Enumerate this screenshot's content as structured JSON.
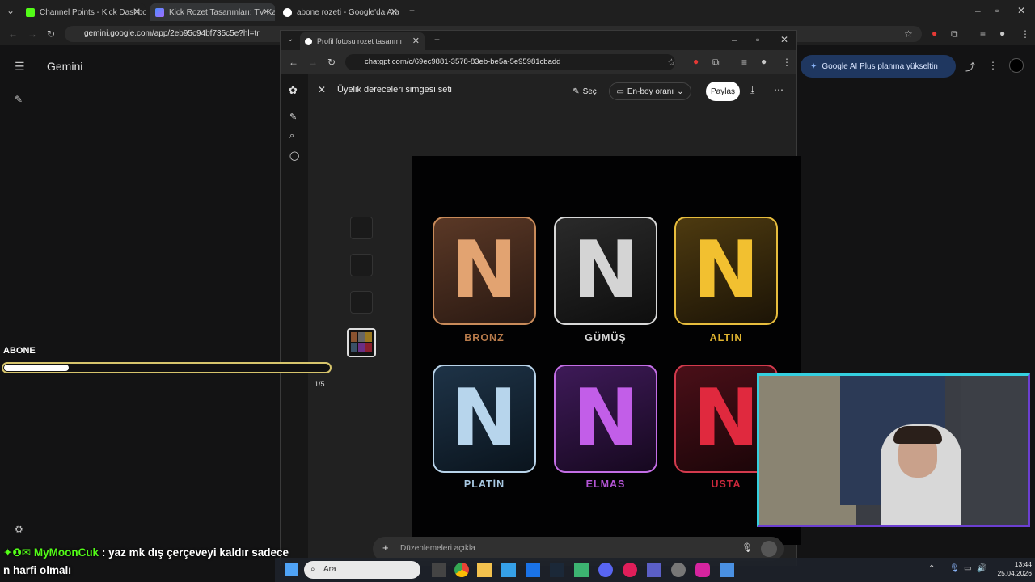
{
  "outer_browser": {
    "tabs": [
      {
        "label": "Channel Points - Kick Dashboar",
        "active": false
      },
      {
        "label": "Kick Rozet Tasarımları: TV Kanal",
        "active": true
      },
      {
        "label": "abone rozeti - Google'da Ara",
        "active": false
      }
    ],
    "url": "gemini.google.com/app/2eb95c94bf735c5e?hl=tr"
  },
  "gemini": {
    "title": "Gemini",
    "upgrade_label": "Google AI Plus planına yükseltin"
  },
  "inner_browser": {
    "tab_label": "Profil fotosu rozet tasarımı",
    "url": "chatgpt.com/c/69ec9881-3578-83eb-be5a-5e95981cbadd"
  },
  "chatgpt": {
    "title": "Üyelik dereceleri simgesi seti",
    "select_label": "Seç",
    "aspect_label": "En-boy oranı",
    "share_label": "Paylaş",
    "composer_placeholder": "Düzenlemeleri açıkla",
    "page_counter": "1/5"
  },
  "badges": [
    {
      "letter": "N",
      "label": "BRONZ",
      "color": "#b87b4b"
    },
    {
      "letter": "N",
      "label": "GÜMÜŞ",
      "color": "#d8d8d8"
    },
    {
      "letter": "N",
      "label": "ALTIN",
      "color": "#e0b430"
    },
    {
      "letter": "N",
      "label": "PLATİN",
      "color": "#a9c9e3"
    },
    {
      "letter": "N",
      "label": "ELMAS",
      "color": "#b455d6"
    },
    {
      "letter": "N",
      "label": "USTA",
      "color": "#c9283b"
    }
  ],
  "stream_overlay": {
    "abone_label": "ABONE",
    "abone_progress_fraction": 0.2,
    "chat_user": "MyMoonCuk",
    "chat_message": ": yaz mk dış çerçeveyi kaldır sadece",
    "chat_message_line2": "n harfi olmalı"
  },
  "taskbar": {
    "search_placeholder": "Ara",
    "time": "13:44",
    "date": "25.04.2026"
  }
}
